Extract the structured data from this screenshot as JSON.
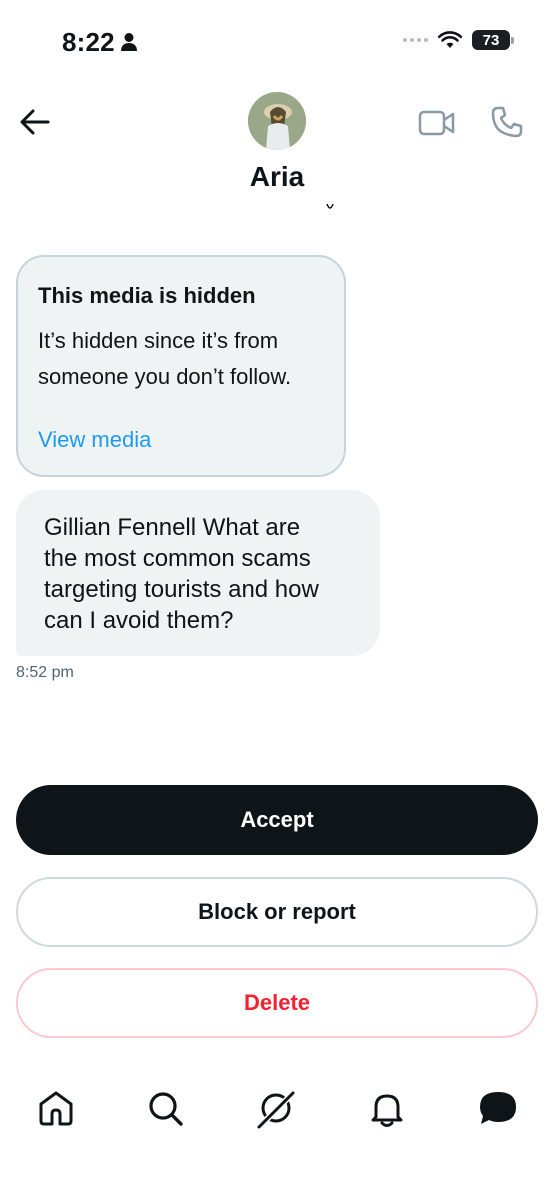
{
  "status_bar": {
    "time": "8:22",
    "battery": "73"
  },
  "header": {
    "contact_name": "Aria"
  },
  "hidden_media": {
    "title": "This media is hidden",
    "description_line1": "It’s hidden since it’s from",
    "description_line2": "someone you don’t follow.",
    "view_link": "View media"
  },
  "message": {
    "lines": [
      "Gillian Fennell What are",
      "the most common scams",
      "targeting tourists and how",
      "can I avoid them?"
    ],
    "timestamp": "8:52 pm"
  },
  "actions": {
    "accept_label": "Accept",
    "block_label": "Block or report",
    "delete_label": "Delete"
  },
  "colors": {
    "accent": "#1d9bf0",
    "danger": "#f4212e",
    "primary_button": "#0f1419",
    "bubble_bg": "#eff3f4"
  },
  "icons": {
    "back": "arrow-left-icon",
    "video": "video-camera-icon",
    "call": "phone-icon",
    "tabs": [
      "home-icon",
      "search-icon",
      "grok-icon",
      "bell-icon",
      "messages-icon"
    ]
  }
}
